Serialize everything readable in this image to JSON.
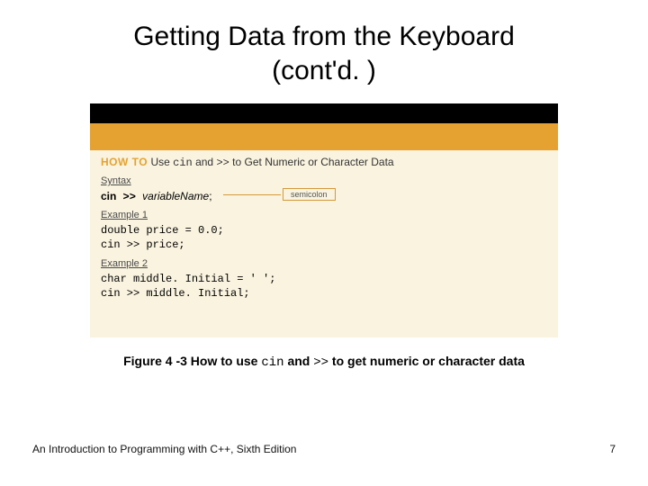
{
  "title_line1": "Getting Data from the Keyboard",
  "title_line2": "(cont'd. )",
  "howto": {
    "prefix": "HOW TO",
    "text_before_cin": " Use ",
    "cin": "cin",
    "text_mid": " and ",
    "op": ">>",
    "text_after": " to Get Numeric or Character Data"
  },
  "labels": {
    "syntax": "Syntax",
    "example1": "Example 1",
    "example2": "Example 2"
  },
  "syntax": {
    "cin": "cin",
    "op": " >> ",
    "var": "variableName",
    "semi": ";",
    "semicolon_label": "semicolon"
  },
  "example1": {
    "line1": "double price = 0.0;",
    "line2": "cin >> price;"
  },
  "example2": {
    "line1": "char middle. Initial = ' ';",
    "line2": "cin >> middle. Initial;"
  },
  "caption": {
    "pre": "Figure 4 -3 How to use ",
    "code_cin": "cin",
    "mid": " and ",
    "code_op": ">>",
    "post": " to get numeric or character data"
  },
  "footer": {
    "book": "An Introduction to Programming with C++, Sixth Edition",
    "page": "7"
  }
}
